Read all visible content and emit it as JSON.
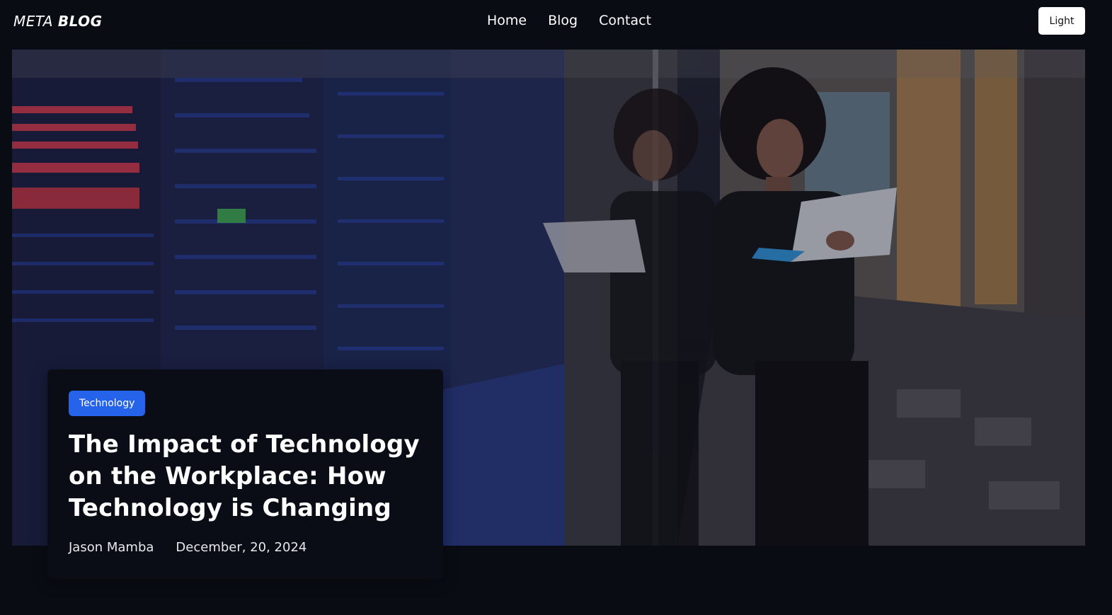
{
  "header": {
    "logo_light": "META",
    "logo_bold": "BLOG",
    "nav": [
      {
        "label": "Home"
      },
      {
        "label": "Blog"
      },
      {
        "label": "Contact"
      }
    ],
    "theme_toggle_label": "Light"
  },
  "hero": {
    "category": "Technology",
    "title": "The Impact of Technology on the Workplace: How Technology is Changing",
    "author": "Jason Mamba",
    "date": "December, 20, 2024"
  },
  "colors": {
    "background": "#0a0c14",
    "accent": "#2563eb",
    "card": "#0b0d16"
  }
}
